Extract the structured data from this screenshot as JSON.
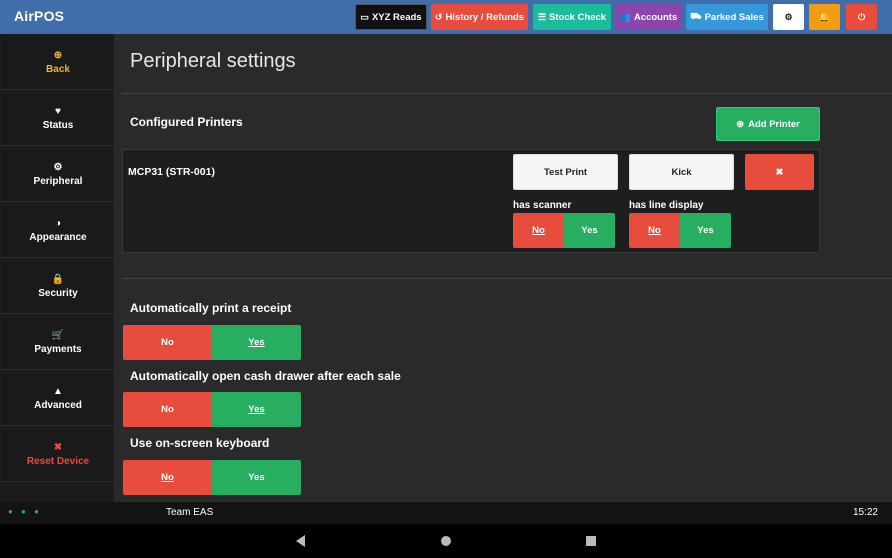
{
  "app": {
    "title": "AirPOS"
  },
  "toolbar": {
    "xyz_reads": {
      "label": "XYZ Reads",
      "icon": "▭"
    },
    "history": {
      "label": "History / Refunds",
      "icon": "↺"
    },
    "stock_check": {
      "label": "Stock Check",
      "icon": "☰"
    },
    "accounts": {
      "label": "Accounts",
      "icon": "👥"
    },
    "parked_sales": {
      "label": "Parked Sales",
      "icon": "⛟"
    },
    "settings_icon": "⚙",
    "bell_icon": "🔔",
    "power_icon": "⏻"
  },
  "colors": {
    "topbar": "#3f6eaa",
    "green": "#27ae60",
    "red": "#e74c3c",
    "purple": "#8e44ad",
    "teal": "#1abc9c",
    "blue": "#3498db",
    "orange": "#f39c12",
    "gold": "#f0b429"
  },
  "sidebar": {
    "items": [
      {
        "label": "Back",
        "icon": "⊕"
      },
      {
        "label": "Status",
        "icon": "♥"
      },
      {
        "label": "Peripheral",
        "icon": "⚙"
      },
      {
        "label": "Appearance",
        "icon": "◑"
      },
      {
        "label": "Security",
        "icon": "🔒"
      },
      {
        "label": "Payments",
        "icon": "🛒"
      },
      {
        "label": "Advanced",
        "icon": "▲"
      },
      {
        "label": "Reset Device",
        "icon": "✖"
      }
    ]
  },
  "main": {
    "title": "Peripheral settings",
    "printers": {
      "section_title": "Configured Printers",
      "add_label": "Add Printer",
      "add_icon": "⊕",
      "items": [
        {
          "name": "MCP31 (STR-001)",
          "test_print": "Test Print",
          "kick": "Kick",
          "delete_icon": "✖",
          "has_scanner": {
            "label": "has scanner",
            "no": "No",
            "yes": "Yes",
            "selected": "no"
          },
          "has_line_display": {
            "label": "has line display",
            "no": "No",
            "yes": "Yes",
            "selected": "no"
          }
        }
      ]
    },
    "settings": [
      {
        "label": "Automatically print a receipt",
        "no": "No",
        "yes": "Yes",
        "selected": "yes"
      },
      {
        "label": "Automatically open cash drawer after each sale",
        "no": "No",
        "yes": "Yes",
        "selected": "yes"
      },
      {
        "label": "Use on-screen keyboard",
        "no": "No",
        "yes": "Yes",
        "selected": "no"
      }
    ]
  },
  "statusbar": {
    "dots": "● ● ●",
    "team": "Team EAS",
    "time": "15:22"
  }
}
